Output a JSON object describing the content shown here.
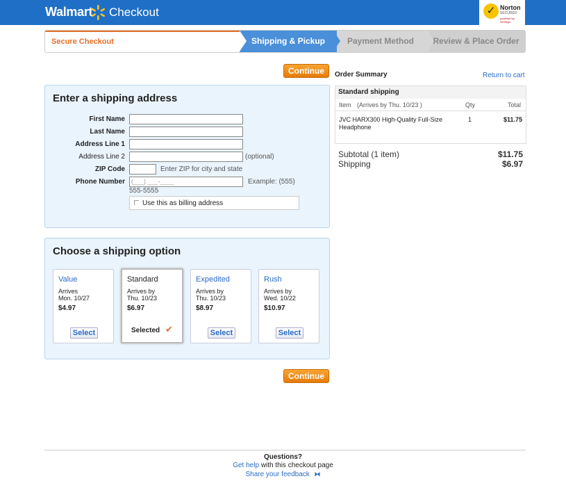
{
  "header": {
    "brand": "Walmart",
    "page_title": "Checkout",
    "norton_title": "Norton",
    "norton_sub": "SECURED",
    "norton_powered": "powered by VeriSign"
  },
  "steps": {
    "secure": "Secure Checkout",
    "shipping": "Shipping & Pickup",
    "payment": "Payment Method",
    "review": "Review & Place Order"
  },
  "continue_label": "Continue",
  "address_form": {
    "title": "Enter a shipping address",
    "first_name": "First Name",
    "last_name": "Last Name",
    "address1": "Address Line 1",
    "address2": "Address Line 2",
    "address2_hint": "(optional)",
    "zip": "ZIP Code",
    "zip_hint": "Enter ZIP for city and state",
    "phone": "Phone Number",
    "phone_placeholder": "(___) ___-____",
    "phone_example_a": "Example: (555)",
    "phone_example_b": "555-5555",
    "billing_label": "Use this as billing address"
  },
  "shipping_options": {
    "title": "Choose a shipping option",
    "select_label": "Select",
    "selected_label": "Selected",
    "options": [
      {
        "name": "Value",
        "arrives": "Arrives",
        "date": "Mon. 10/27",
        "price": "$4.97"
      },
      {
        "name": "Standard",
        "arrives": "Arrives by",
        "date": "Thu. 10/23",
        "price": "$6.97"
      },
      {
        "name": "Expedited",
        "arrives": "Arrives by",
        "date": "Thu. 10/23",
        "price": "$8.97"
      },
      {
        "name": "Rush",
        "arrives": "Arrives by",
        "date": "Wed. 10/22",
        "price": "$10.97"
      }
    ]
  },
  "order_summary": {
    "title": "Order Summary",
    "return_link": "Return to cart",
    "shipping_method": "Standard shipping",
    "col_item": "Item",
    "col_arrives": "(Arrives by Thu. 10/23 )",
    "col_qty": "Qty",
    "col_total": "Total",
    "item_name": "JVC HARX300 High-Quality Full-Size Headphone",
    "item_qty": "1",
    "item_total": "$11.75",
    "subtotal_label": "Subtotal (1 item)",
    "subtotal_value": "$11.75",
    "shipping_label": "Shipping",
    "shipping_value": "$6.97"
  },
  "footer": {
    "questions": "Questions?",
    "get_help": "Get help",
    "help_rest": "with this checkout page",
    "share": "Share your feedback"
  },
  "colors": {
    "header_blue": "#1f6fc6",
    "accent_orange": "#e2702a",
    "link_blue": "#2a6bc6"
  }
}
